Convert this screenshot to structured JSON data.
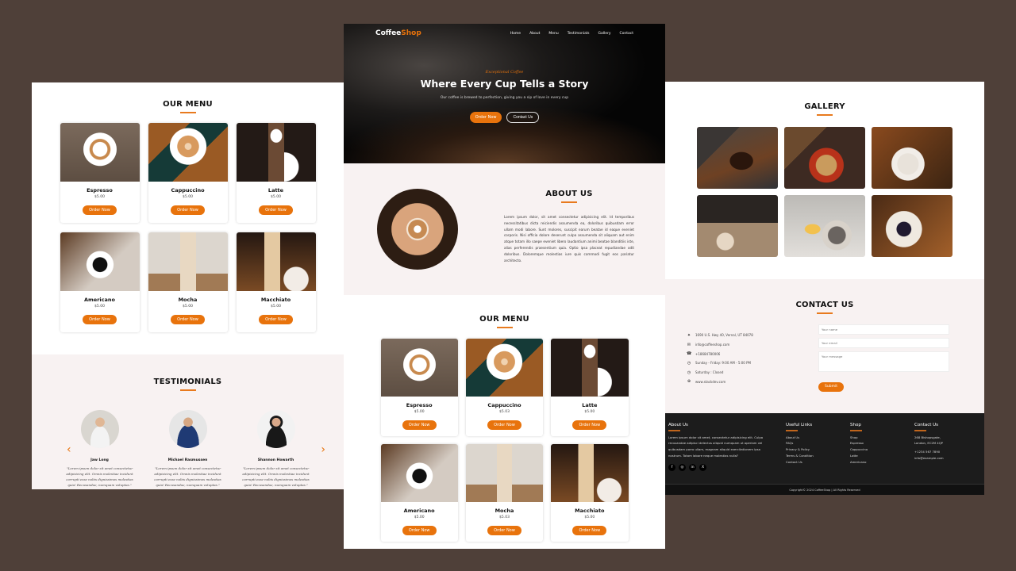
{
  "brand": {
    "name_first": "Coffee",
    "name_second": "Shop",
    "accent": "#e8730c",
    "background": "#4f4039"
  },
  "nav": {
    "items": [
      "Home",
      "About",
      "Menu",
      "Testimonials",
      "Gallery",
      "Contact"
    ]
  },
  "hero": {
    "tagline": "Exceptional Coffee",
    "title": "Where Every Cup Tells a Story",
    "subtitle": "Our coffee is brewed to perfection, giving you a sip of love in every cup",
    "primary_button": "Order Now",
    "secondary_button": "Contact Us"
  },
  "about": {
    "title": "ABOUT US",
    "text": "Lorem ipsum dolor, sit amet consectetur adipisicing elit. Id temporibus necessitatibus dicta reiciendis assumenda ea, doloribus quibusdam error ullam modi labore. Sunt molores, suscipit earum beatae id eaque eveniet corporis. Nisi officia dolore deserunt culpa assumenda sit aliquam aut enim atque totam illo saepe eveniet libero laudantium animi beatae blanditiis iste, alias perferendis praesentium quia. Optio ipsa placeat repudiandae odit doloribus. Doloremque molestias iure quis commodi fugit eos pariatur architecto."
  },
  "menu": {
    "title": "OUR MENU",
    "items_center": [
      {
        "name": "Espresso",
        "price": "$5.00",
        "button": "Order Now"
      },
      {
        "name": "Cappuccino",
        "price": "$5.03",
        "button": "Order Now"
      },
      {
        "name": "Latte",
        "price": "$5.00",
        "button": "Order Now"
      },
      {
        "name": "Americano",
        "price": "$5.00",
        "button": "Order Now"
      },
      {
        "name": "Mocha",
        "price": "$5.03",
        "button": "Order Now"
      },
      {
        "name": "Macchiato",
        "price": "$5.00",
        "button": "Order Now"
      }
    ],
    "items_left": [
      {
        "name": "Espresso",
        "price": "$5.00",
        "button": "Order Now"
      },
      {
        "name": "Cappuccino",
        "price": "$5.00",
        "button": "Order Now"
      },
      {
        "name": "Latte",
        "price": "$5.00",
        "button": "Order Now"
      },
      {
        "name": "Americano",
        "price": "$5.00",
        "button": "Order Now"
      },
      {
        "name": "Mocha",
        "price": "$5.00",
        "button": "Order Now"
      },
      {
        "name": "Macchiato",
        "price": "$5.00",
        "button": "Order Now"
      }
    ]
  },
  "testimonials": {
    "title": "TESTIMONIALS",
    "prev_icon": "chevron-left-icon",
    "next_icon": "chevron-right-icon",
    "people": [
      {
        "name": "Jaw Long",
        "quote": "\"Lorem ipsum dolor sit amet consectetur adipisicing elit. Omnis molestiae incidunt corrupti esse nobis dignissimos molestias quia! Recusandae, numquam voluptas.\""
      },
      {
        "name": "Michael Rasmussen",
        "quote": "\"Lorem ipsum dolor sit amet consectetur adipisicing elit. Omnis molestiae incidunt corrupti esse nobis dignissimos molestias quia! Recusandae, numquam voluptas.\""
      },
      {
        "name": "Shannon Howarth",
        "quote": "\"Lorem ipsum dolor sit amet consectetur adipisicing elit. Omnis molestiae incidunt corrupti esse nobis dignissimos molestias quia! Recusandae, numquam voluptas.\""
      }
    ]
  },
  "gallery": {
    "title": "GALLERY"
  },
  "contact": {
    "title": "CONTACT US",
    "info": [
      {
        "icon": "location-icon",
        "glyph": "✦",
        "text": "1690 U.S. Hwy 40, Vernal, UT 84078"
      },
      {
        "icon": "mail-icon",
        "glyph": "✉",
        "text": "info@coffeeshop.com"
      },
      {
        "icon": "phone-icon",
        "glyph": "☎",
        "text": "+18684780006"
      },
      {
        "icon": "clock-icon",
        "glyph": "◷",
        "text": "Sunday - Friday: 9:00 AM - 5:00 PM"
      },
      {
        "icon": "clock-icon",
        "glyph": "◷",
        "text": "Saturday : Closed"
      },
      {
        "icon": "globe-icon",
        "glyph": "⊕",
        "text": "www.stackdev.com"
      }
    ],
    "form": {
      "name_placeholder": "Your name",
      "email_placeholder": "Your email",
      "message_placeholder": "Your message",
      "submit": "Submit"
    }
  },
  "footer": {
    "about": {
      "title": "About Us",
      "text": "Lorem ipsum dolor sit amet, consectetur adipisicing elit. Culpa recusandae adipisci delectus aliquid numquam ut aperiam vel quibusdam porro ullam, magnam aliquid exercitationem ipsa nostrum. Totam labore neque molestias nulla?",
      "social": [
        "facebook-icon",
        "instagram-icon",
        "linkedin-icon",
        "x-icon"
      ]
    },
    "links": {
      "title": "Useful Links",
      "items": [
        "About Us",
        "FAQs",
        "Privacy & Policy",
        "Terms & Condition",
        "Contact Us"
      ]
    },
    "shop": {
      "title": "Shop",
      "items": [
        "Shop",
        "Espresso",
        "Cappuccino",
        "Latte",
        "Americano"
      ]
    },
    "contact": {
      "title": "Contact Us",
      "address1": "268 Bishopsgate,",
      "address2": "London, EC2M 4QP",
      "phone": "+1234 567 7890",
      "email": "info@example.com"
    },
    "copyright": "Copyright© 2024 CoffeeShop | All Rights Reserved"
  }
}
